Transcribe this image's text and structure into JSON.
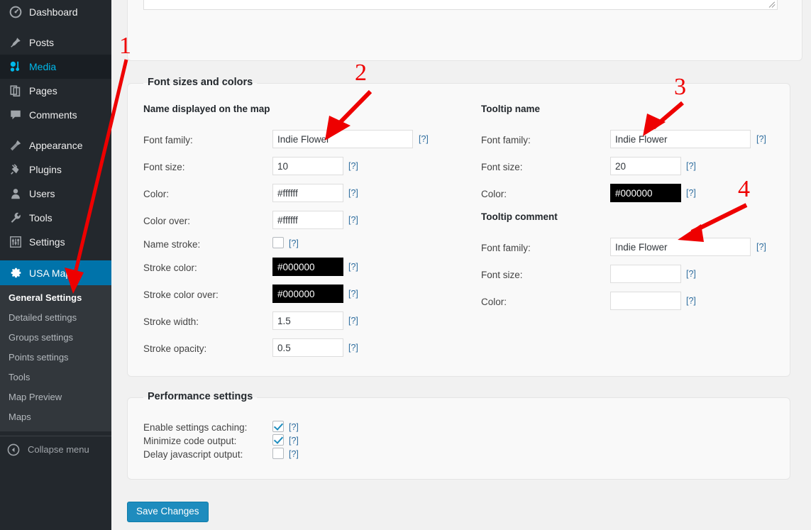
{
  "sidebar": {
    "items": [
      {
        "label": "Dashboard",
        "icon": "dashboard-icon",
        "state": "normal"
      },
      {
        "label": "Posts",
        "icon": "pin-icon",
        "state": "normal"
      },
      {
        "label": "Media",
        "icon": "media-icon",
        "state": "highlight"
      },
      {
        "label": "Pages",
        "icon": "pages-icon",
        "state": "normal"
      },
      {
        "label": "Comments",
        "icon": "comments-icon",
        "state": "normal"
      },
      {
        "label": "Appearance",
        "icon": "appearance-icon",
        "state": "normal"
      },
      {
        "label": "Plugins",
        "icon": "plugins-icon",
        "state": "normal"
      },
      {
        "label": "Users",
        "icon": "users-icon",
        "state": "normal"
      },
      {
        "label": "Tools",
        "icon": "tools-icon",
        "state": "normal"
      },
      {
        "label": "Settings",
        "icon": "settings-icon",
        "state": "normal"
      }
    ],
    "current_menu": {
      "label": "USA Map",
      "icon": "gear-icon"
    },
    "submenu": [
      {
        "label": "General Settings",
        "current": true
      },
      {
        "label": "Detailed settings",
        "current": false
      },
      {
        "label": "Groups settings",
        "current": false
      },
      {
        "label": "Points settings",
        "current": false
      },
      {
        "label": "Tools",
        "current": false
      },
      {
        "label": "Map Preview",
        "current": false
      },
      {
        "label": "Maps",
        "current": false
      }
    ],
    "collapse": {
      "label": "Collapse menu",
      "icon": "collapse-arrow-icon"
    },
    "colors": {
      "background": "#23282d",
      "submenu_background": "#32373c",
      "current": "#0073aa",
      "highlight_text": "#00b9eb"
    }
  },
  "main": {
    "textarea": {
      "value": "",
      "placeholder": ""
    },
    "font_panel": {
      "legend": "Font sizes and colors",
      "left": {
        "group_title": "Name displayed on the map",
        "fields": [
          {
            "label": "Font family:",
            "value": "Indie Flower",
            "help": "[?]",
            "type": "text-wide"
          },
          {
            "label": "Font size:",
            "value": "10",
            "help": "[?]",
            "type": "text-narrow"
          },
          {
            "label": "Color:",
            "value": "#ffffff",
            "help": "[?]",
            "type": "text-narrow"
          },
          {
            "label": "Color over:",
            "value": "#ffffff",
            "help": "[?]",
            "type": "text-narrow"
          },
          {
            "label": "Name stroke:",
            "value": "",
            "help": "[?]",
            "type": "checkbox",
            "checked": false
          },
          {
            "label": "Stroke color:",
            "value": "#000000",
            "help": "[?]",
            "type": "text-narrow-dark"
          },
          {
            "label": "Stroke color over:",
            "value": "#000000",
            "help": "[?]",
            "type": "text-narrow-dark"
          },
          {
            "label": "Stroke width:",
            "value": "1.5",
            "help": "[?]",
            "type": "text-narrow"
          },
          {
            "label": "Stroke opacity:",
            "value": "0.5",
            "help": "[?]",
            "type": "text-narrow"
          }
        ]
      },
      "right": {
        "group_title_1": "Tooltip name",
        "group_title_2": "Tooltip comment",
        "fields_1": [
          {
            "label": "Font family:",
            "value": "Indie Flower",
            "help": "[?]",
            "type": "text-wide"
          },
          {
            "label": "Font size:",
            "value": "20",
            "help": "[?]",
            "type": "text-narrow"
          },
          {
            "label": "Color:",
            "value": "#000000",
            "help": "[?]",
            "type": "text-narrow-dark"
          }
        ],
        "fields_2": [
          {
            "label": "Font family:",
            "value": "Indie Flower",
            "help": "[?]",
            "type": "text-wide"
          },
          {
            "label": "Font size:",
            "value": "",
            "help": "[?]",
            "type": "text-narrow"
          },
          {
            "label": "Color:",
            "value": "",
            "help": "[?]",
            "type": "text-narrow"
          }
        ]
      }
    },
    "performance_panel": {
      "legend": "Performance settings",
      "rows": [
        {
          "label": "Enable settings caching:",
          "help": "[?]",
          "checked": true
        },
        {
          "label": "Minimize code output:",
          "help": "[?]",
          "checked": true
        },
        {
          "label": "Delay javascript output:",
          "help": "[?]",
          "checked": false
        }
      ]
    },
    "save_button": "Save Changes"
  },
  "annotations": {
    "color": "#ee0000",
    "markers": [
      {
        "number": "1",
        "target": "sidebar-submenu-general-settings"
      },
      {
        "number": "2",
        "target": "name-font-family-field"
      },
      {
        "number": "3",
        "target": "tooltip-name-font-family-field"
      },
      {
        "number": "4",
        "target": "tooltip-comment-font-family-field"
      }
    ]
  }
}
